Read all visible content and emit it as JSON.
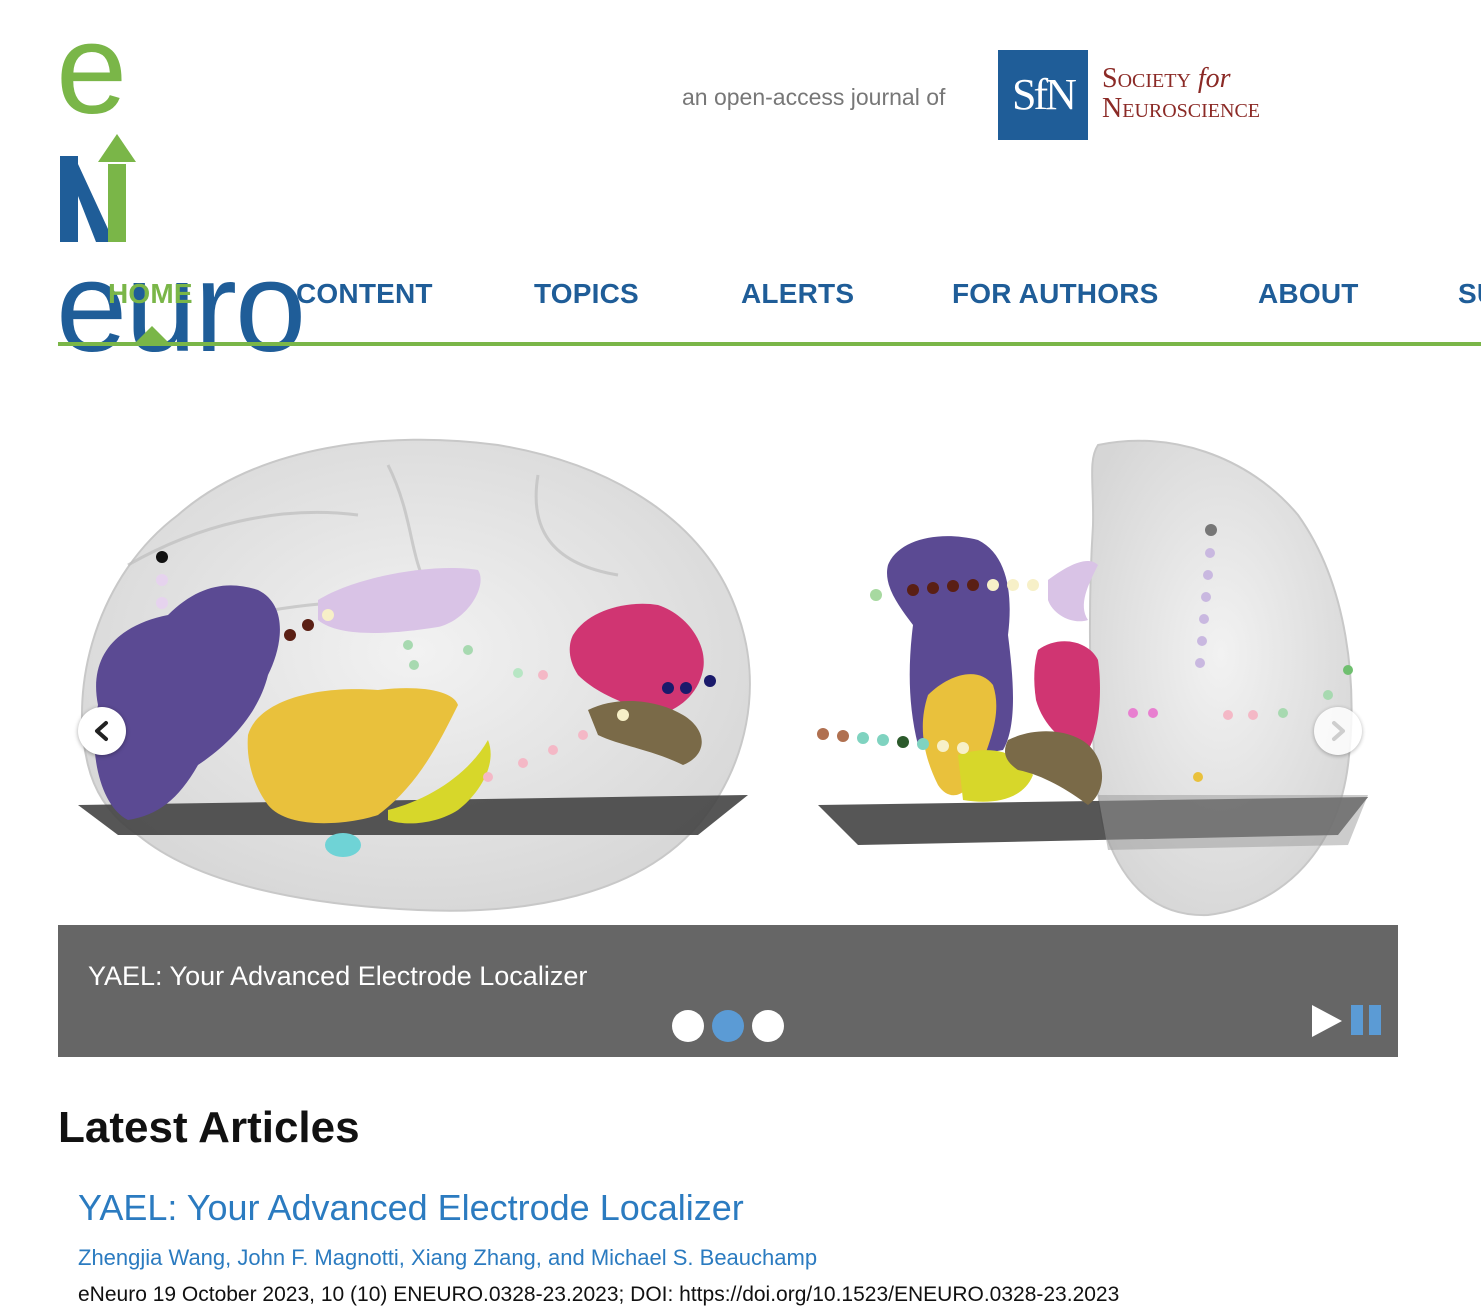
{
  "header": {
    "logo_e": "e",
    "logo_rest": "euro",
    "tagline": "an open-access journal of",
    "sfn_mark": "SfN",
    "society_line1": "Society",
    "society_for": "for",
    "society_line2": "Neuroscience"
  },
  "nav": {
    "items": [
      {
        "label": "HOME",
        "active": true
      },
      {
        "label": "CONTENT"
      },
      {
        "label": "TOPICS"
      },
      {
        "label": "ALERTS"
      },
      {
        "label": "FOR AUTHORS"
      },
      {
        "label": "ABOUT"
      },
      {
        "label": "SU"
      }
    ]
  },
  "carousel": {
    "caption": "YAEL: Your Advanced Electrode Localizer",
    "slide_count": 3,
    "active_slide": 2,
    "prev_icon": "chevron-left-icon",
    "next_icon": "chevron-right-icon",
    "play_icon": "play-icon",
    "pause_icon": "pause-icon"
  },
  "latest": {
    "heading": "Latest Articles",
    "articles": [
      {
        "title": "YAEL: Your Advanced Electrode Localizer",
        "authors": "Zhengjia Wang, John F. Magnotti, Xiang Zhang, and Michael S. Beauchamp",
        "meta": "eNeuro 19 October 2023, 10 (10) ENEURO.0328-23.2023; DOI: https://doi.org/10.1523/ENEURO.0328-23.2023"
      }
    ]
  },
  "colors": {
    "brand_green": "#7ab648",
    "brand_blue": "#1f5d98",
    "link_blue": "#2b7bc0",
    "sfn_red": "#8b2a26",
    "caption_bar": "#666666",
    "dot_active": "#5b9bd5"
  }
}
